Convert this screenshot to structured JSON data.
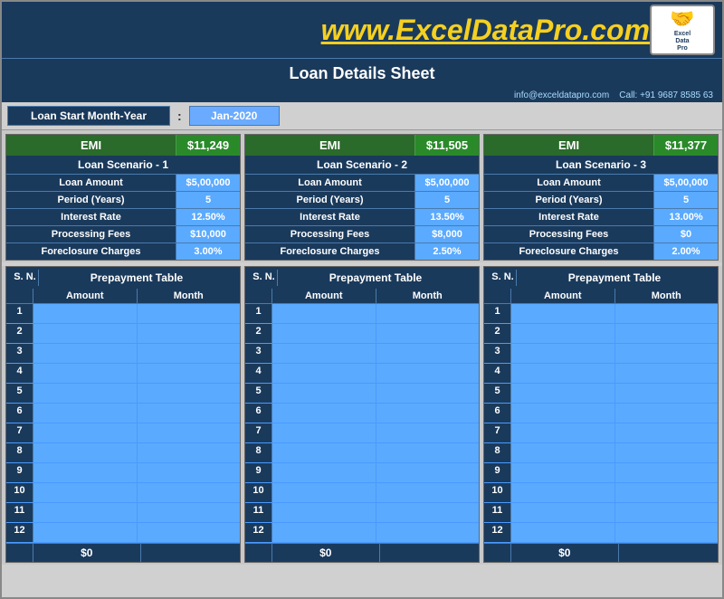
{
  "header": {
    "title": "www.ExcelDataPro.com",
    "subtitle": "Loan Details Sheet",
    "contact_email": "info@exceldatapro.com",
    "contact_phone": "Call: +91 9687 8585 63"
  },
  "loan_start": {
    "label": "Loan Start Month-Year",
    "colon": ":",
    "value": "Jan-2020"
  },
  "scenarios": [
    {
      "emi_label": "EMI",
      "emi_value": "$11,249",
      "scenario_label": "Loan Scenario - 1",
      "rows": [
        {
          "label": "Loan Amount",
          "value": "$5,00,000"
        },
        {
          "label": "Period (Years)",
          "value": "5"
        },
        {
          "label": "Interest Rate",
          "value": "12.50%"
        },
        {
          "label": "Processing Fees",
          "value": "$10,000"
        },
        {
          "label": "Foreclosure Charges",
          "value": "3.00%"
        }
      ]
    },
    {
      "emi_label": "EMI",
      "emi_value": "$11,505",
      "scenario_label": "Loan Scenario - 2",
      "rows": [
        {
          "label": "Loan Amount",
          "value": "$5,00,000"
        },
        {
          "label": "Period (Years)",
          "value": "5"
        },
        {
          "label": "Interest Rate",
          "value": "13.50%"
        },
        {
          "label": "Processing Fees",
          "value": "$8,000"
        },
        {
          "label": "Foreclosure Charges",
          "value": "2.50%"
        }
      ]
    },
    {
      "emi_label": "EMI",
      "emi_value": "$11,377",
      "scenario_label": "Loan Scenario - 3",
      "rows": [
        {
          "label": "Loan Amount",
          "value": "$5,00,000"
        },
        {
          "label": "Period (Years)",
          "value": "5"
        },
        {
          "label": "Interest Rate",
          "value": "13.00%"
        },
        {
          "label": "Processing Fees",
          "value": "$0"
        },
        {
          "label": "Foreclosure Charges",
          "value": "2.00%"
        }
      ]
    }
  ],
  "prepay": {
    "title": "Prepayment Table",
    "col_amount": "Amount",
    "col_month": "Month",
    "rows": [
      1,
      2,
      3,
      4,
      5,
      6,
      7,
      8,
      9,
      10,
      11,
      12
    ],
    "total": "$0"
  },
  "logo": {
    "icon": "🤝",
    "label": "Excel\nData\nPro"
  }
}
